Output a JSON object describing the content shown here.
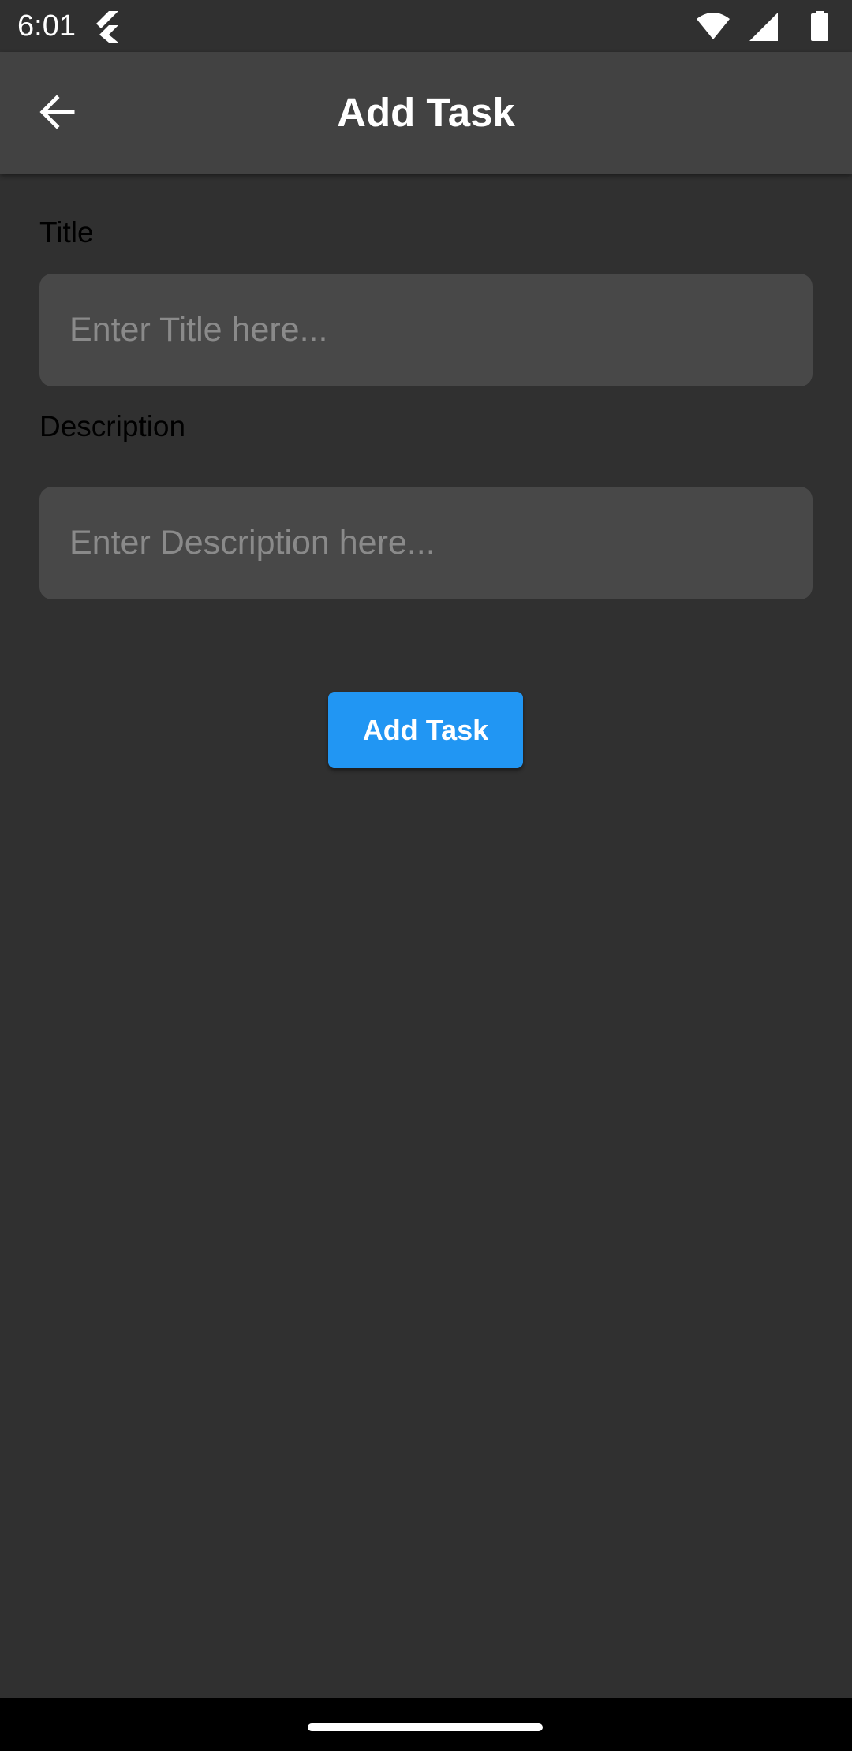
{
  "status_bar": {
    "time": "6:01",
    "icons": [
      "flutter-icon",
      "wifi-icon",
      "signal-icon",
      "battery-icon"
    ]
  },
  "app_bar": {
    "title": "Add Task",
    "back_icon": "arrow-back-icon"
  },
  "form": {
    "title_label": "Title",
    "title_placeholder": "Enter Title here...",
    "title_value": "",
    "description_label": "Description",
    "description_placeholder": "Enter Description here...",
    "description_value": "",
    "submit_label": "Add Task"
  },
  "colors": {
    "background": "#303030",
    "app_bar": "#424242",
    "input_fill": "#484848",
    "accent": "#2196f3"
  }
}
